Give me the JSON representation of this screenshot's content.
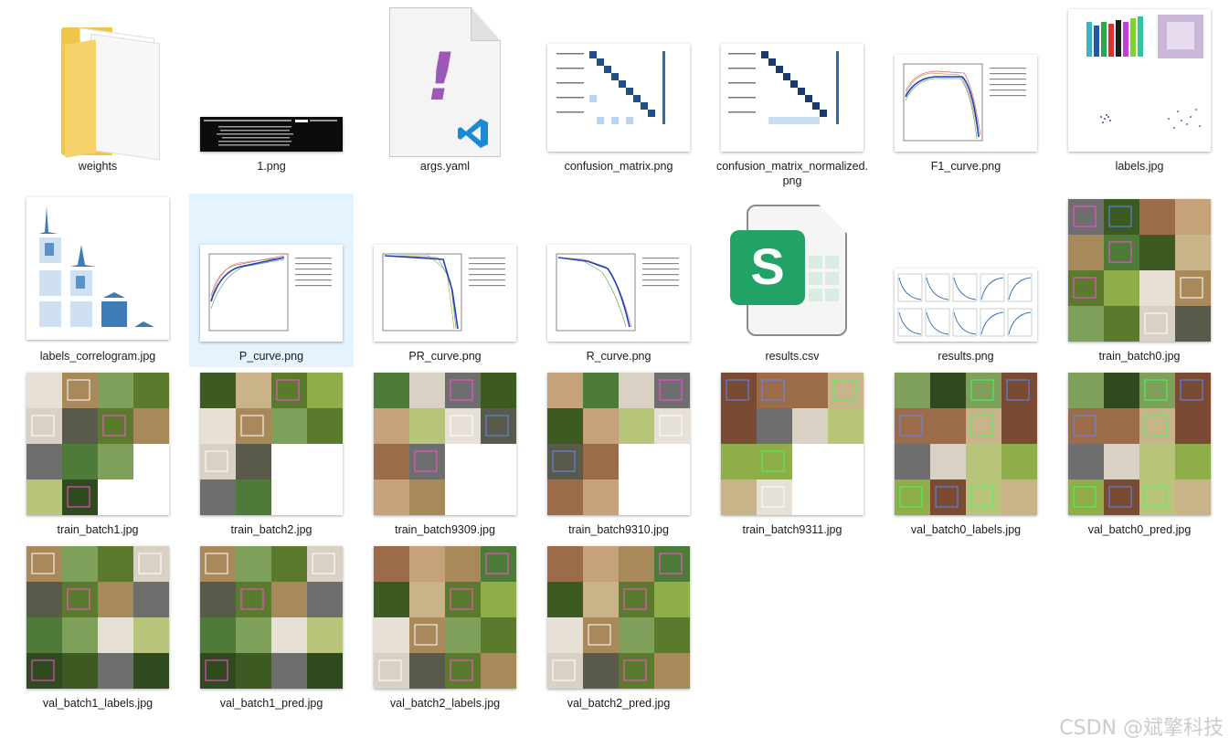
{
  "files": [
    {
      "name": "weights",
      "kind": "folder"
    },
    {
      "name": "1.png",
      "kind": "terminal"
    },
    {
      "name": "args.yaml",
      "kind": "yaml"
    },
    {
      "name": "confusion_matrix.png",
      "kind": "matrix"
    },
    {
      "name": "confusion_matrix_normalized.png",
      "kind": "matrix"
    },
    {
      "name": "F1_curve.png",
      "kind": "curve"
    },
    {
      "name": "labels.jpg",
      "kind": "labels"
    },
    {
      "name": "labels_correlogram.jpg",
      "kind": "correlogram"
    },
    {
      "name": "P_curve.png",
      "kind": "curve",
      "selected": true
    },
    {
      "name": "PR_curve.png",
      "kind": "curve"
    },
    {
      "name": "R_curve.png",
      "kind": "curve"
    },
    {
      "name": "results.csv",
      "kind": "csv"
    },
    {
      "name": "results.png",
      "kind": "results"
    },
    {
      "name": "train_batch0.jpg",
      "kind": "mosaic"
    },
    {
      "name": "train_batch1.jpg",
      "kind": "mosaic"
    },
    {
      "name": "train_batch2.jpg",
      "kind": "mosaic"
    },
    {
      "name": "train_batch9309.jpg",
      "kind": "mosaic"
    },
    {
      "name": "train_batch9310.jpg",
      "kind": "mosaic"
    },
    {
      "name": "train_batch9311.jpg",
      "kind": "mosaic"
    },
    {
      "name": "val_batch0_labels.jpg",
      "kind": "mosaic"
    },
    {
      "name": "val_batch0_pred.jpg",
      "kind": "mosaic"
    },
    {
      "name": "val_batch1_labels.jpg",
      "kind": "mosaic"
    },
    {
      "name": "val_batch1_pred.jpg",
      "kind": "mosaic"
    },
    {
      "name": "val_batch2_labels.jpg",
      "kind": "mosaic"
    },
    {
      "name": "val_batch2_pred.jpg",
      "kind": "mosaic"
    }
  ],
  "icons": {
    "folder": "folder-icon",
    "yaml": "yaml-file-icon",
    "csv": "spreadsheet-file-icon",
    "editor": "vscode-icon"
  },
  "colors": {
    "selection": "#e5f3ff",
    "csv_badge": "#21a366",
    "yaml_mark": "#9b59b6",
    "folder": "#f0c64a",
    "chart_blue": "#1f3dbd"
  },
  "watermark": "CSDN @斌擎科技"
}
